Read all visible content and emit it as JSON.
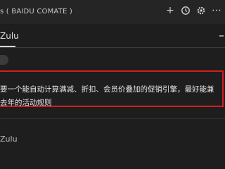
{
  "header": {
    "title": "s ( BAIDU COMATE )",
    "actions": [
      {
        "icon": "plus-icon",
        "glyph": "+"
      },
      {
        "icon": "history-icon",
        "glyph": "⟲"
      },
      {
        "icon": "gear-icon",
        "glyph": "⚙"
      },
      {
        "icon": "more-icon",
        "glyph": "⋯"
      }
    ]
  },
  "tabs": {
    "active_label": "Zulu"
  },
  "message": {
    "line1": "要一个能自动计算满减、折扣、会员价叠加的促销引擎，最好能兼",
    "line2": "去年的活动规则"
  },
  "section2": {
    "label": "Zulu"
  },
  "colors": {
    "highlight_border": "#d21f1f",
    "background": "#1e1e1e"
  }
}
